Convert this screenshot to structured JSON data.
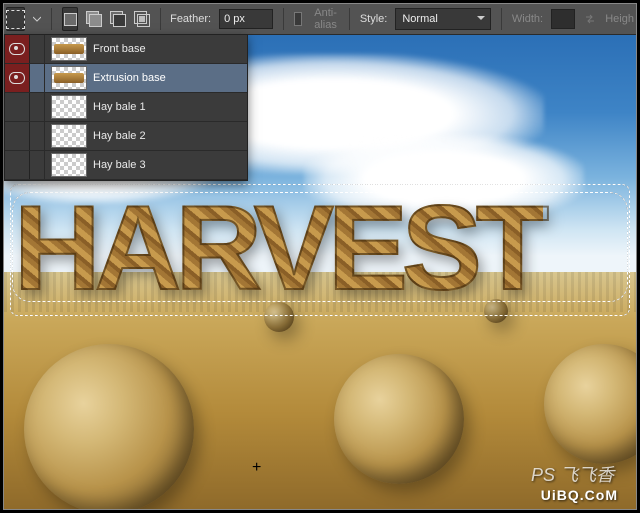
{
  "toolbar": {
    "feather_label": "Feather:",
    "feather_value": "0 px",
    "antialias_label": "Anti-alias",
    "style_label": "Style:",
    "style_value": "Normal",
    "width_label": "Width:",
    "height_label": "Heigh"
  },
  "layers": {
    "items": [
      {
        "name": "Front base",
        "visible": true,
        "selected": false,
        "thumb": "text"
      },
      {
        "name": "Extrusion base",
        "visible": true,
        "selected": true,
        "thumb": "text"
      },
      {
        "name": "Hay bale 1",
        "visible": false,
        "selected": false,
        "thumb": "check"
      },
      {
        "name": "Hay bale 2",
        "visible": false,
        "selected": false,
        "thumb": "check"
      },
      {
        "name": "Hay bale 3",
        "visible": false,
        "selected": false,
        "thumb": "check"
      }
    ]
  },
  "canvas": {
    "text_word": "HARVEST",
    "watermark_a": "PS 飞飞香",
    "watermark_b": "UiBQ.CoM"
  }
}
